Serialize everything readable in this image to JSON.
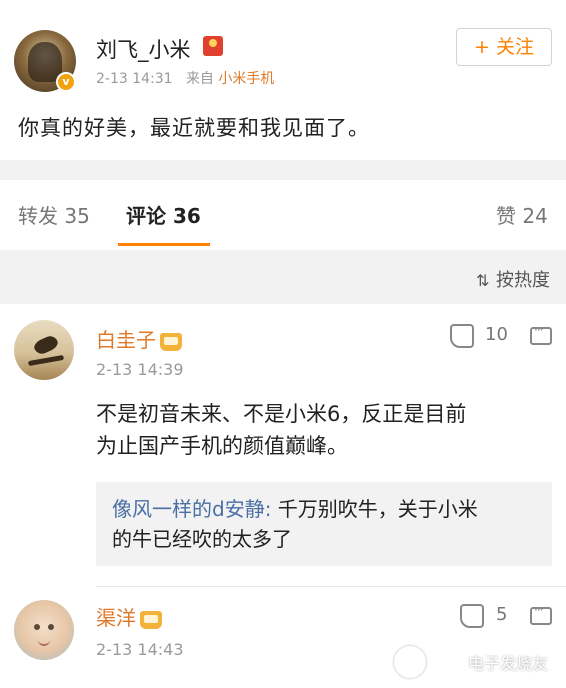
{
  "post": {
    "author": "刘飞_小米",
    "time": "2-13 14:31",
    "source_prefix": "来自",
    "source": "小米手机",
    "follow_label": "+ 关注",
    "text": "你真的好美，最近就要和我见面了。",
    "verified_badge": "v"
  },
  "tabs": {
    "forward": "转发 35",
    "comment": "评论 36",
    "like": "赞 24"
  },
  "sort": {
    "label": "按热度",
    "icon": "sort-icon"
  },
  "comments": [
    {
      "name": "白圭子",
      "time": "2-13 14:39",
      "likes": "10",
      "text_line1": "不是初音未来、不是小米6，反正是目前",
      "text_line2": "为止国产手机的颜值巅峰。",
      "reply_user": "像风一样的d安静:",
      "reply_text_line1": " 千万别吹牛，关于小米",
      "reply_text_line2": "的牛已经吹的太多了"
    },
    {
      "name": "渠洋",
      "time": "2-13 14:43",
      "likes": "5"
    }
  ],
  "watermark": "电子发烧友",
  "colors": {
    "accent": "#ff8200",
    "username": "#e07a2a",
    "reply_user": "#4a6fa5",
    "band": "#f2f2f2"
  }
}
